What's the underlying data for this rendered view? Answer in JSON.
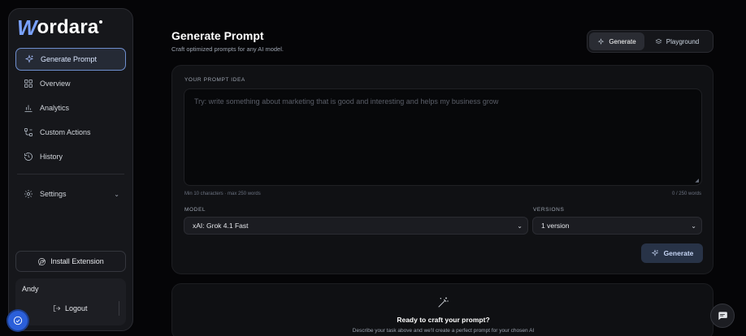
{
  "brand": {
    "logo_letter": "W",
    "logo_rest": "ordara",
    "accent": "#7aa2ff"
  },
  "sidebar": {
    "items": [
      {
        "label": "Generate Prompt",
        "icon": "sparkles-icon",
        "active": true
      },
      {
        "label": "Overview",
        "icon": "grid-icon"
      },
      {
        "label": "Analytics",
        "icon": "bar-chart-icon"
      },
      {
        "label": "Custom Actions",
        "icon": "workflow-icon"
      },
      {
        "label": "History",
        "icon": "history-icon"
      }
    ],
    "settings_label": "Settings",
    "install_label": "Install Extension",
    "user_name": "Andy",
    "logout_label": "Logout"
  },
  "header": {
    "title": "Generate Prompt",
    "subtitle": "Craft optimized prompts for any AI model.",
    "modes": [
      {
        "label": "Generate",
        "icon": "sparkles-icon",
        "active": true
      },
      {
        "label": "Playground",
        "icon": "layers-icon",
        "active": false
      }
    ]
  },
  "form": {
    "prompt_label": "YOUR PROMPT IDEA",
    "prompt_placeholder": "Try: write something about marketing that is good and interesting and helps my business grow",
    "hint_left": "Min 10 characters · max 250 words",
    "hint_right": "0 / 250 words",
    "model_label": "MODEL",
    "model_value": "xAI: Grok 4.1 Fast",
    "versions_label": "VERSIONS",
    "versions_value": "1 version",
    "generate_label": "Generate"
  },
  "empty_state": {
    "title": "Ready to craft your prompt?",
    "subtitle": "Describe your task above and we'll create a perfect prompt for your chosen AI"
  }
}
